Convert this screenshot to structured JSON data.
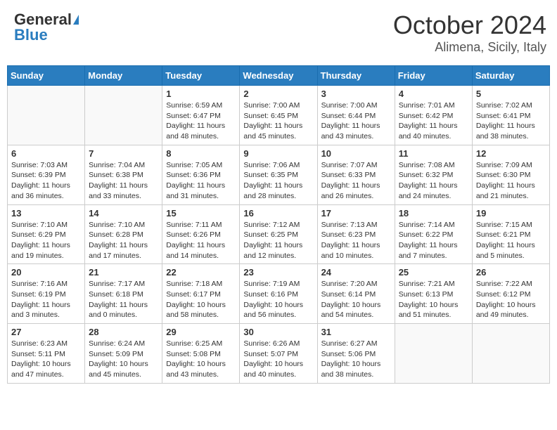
{
  "header": {
    "logo_general": "General",
    "logo_blue": "Blue",
    "title": "October 2024",
    "subtitle": "Alimena, Sicily, Italy"
  },
  "days_of_week": [
    "Sunday",
    "Monday",
    "Tuesday",
    "Wednesday",
    "Thursday",
    "Friday",
    "Saturday"
  ],
  "weeks": [
    [
      {
        "day": "",
        "info": ""
      },
      {
        "day": "",
        "info": ""
      },
      {
        "day": "1",
        "info": "Sunrise: 6:59 AM\nSunset: 6:47 PM\nDaylight: 11 hours and 48 minutes."
      },
      {
        "day": "2",
        "info": "Sunrise: 7:00 AM\nSunset: 6:45 PM\nDaylight: 11 hours and 45 minutes."
      },
      {
        "day": "3",
        "info": "Sunrise: 7:00 AM\nSunset: 6:44 PM\nDaylight: 11 hours and 43 minutes."
      },
      {
        "day": "4",
        "info": "Sunrise: 7:01 AM\nSunset: 6:42 PM\nDaylight: 11 hours and 40 minutes."
      },
      {
        "day": "5",
        "info": "Sunrise: 7:02 AM\nSunset: 6:41 PM\nDaylight: 11 hours and 38 minutes."
      }
    ],
    [
      {
        "day": "6",
        "info": "Sunrise: 7:03 AM\nSunset: 6:39 PM\nDaylight: 11 hours and 36 minutes."
      },
      {
        "day": "7",
        "info": "Sunrise: 7:04 AM\nSunset: 6:38 PM\nDaylight: 11 hours and 33 minutes."
      },
      {
        "day": "8",
        "info": "Sunrise: 7:05 AM\nSunset: 6:36 PM\nDaylight: 11 hours and 31 minutes."
      },
      {
        "day": "9",
        "info": "Sunrise: 7:06 AM\nSunset: 6:35 PM\nDaylight: 11 hours and 28 minutes."
      },
      {
        "day": "10",
        "info": "Sunrise: 7:07 AM\nSunset: 6:33 PM\nDaylight: 11 hours and 26 minutes."
      },
      {
        "day": "11",
        "info": "Sunrise: 7:08 AM\nSunset: 6:32 PM\nDaylight: 11 hours and 24 minutes."
      },
      {
        "day": "12",
        "info": "Sunrise: 7:09 AM\nSunset: 6:30 PM\nDaylight: 11 hours and 21 minutes."
      }
    ],
    [
      {
        "day": "13",
        "info": "Sunrise: 7:10 AM\nSunset: 6:29 PM\nDaylight: 11 hours and 19 minutes."
      },
      {
        "day": "14",
        "info": "Sunrise: 7:10 AM\nSunset: 6:28 PM\nDaylight: 11 hours and 17 minutes."
      },
      {
        "day": "15",
        "info": "Sunrise: 7:11 AM\nSunset: 6:26 PM\nDaylight: 11 hours and 14 minutes."
      },
      {
        "day": "16",
        "info": "Sunrise: 7:12 AM\nSunset: 6:25 PM\nDaylight: 11 hours and 12 minutes."
      },
      {
        "day": "17",
        "info": "Sunrise: 7:13 AM\nSunset: 6:23 PM\nDaylight: 11 hours and 10 minutes."
      },
      {
        "day": "18",
        "info": "Sunrise: 7:14 AM\nSunset: 6:22 PM\nDaylight: 11 hours and 7 minutes."
      },
      {
        "day": "19",
        "info": "Sunrise: 7:15 AM\nSunset: 6:21 PM\nDaylight: 11 hours and 5 minutes."
      }
    ],
    [
      {
        "day": "20",
        "info": "Sunrise: 7:16 AM\nSunset: 6:19 PM\nDaylight: 11 hours and 3 minutes."
      },
      {
        "day": "21",
        "info": "Sunrise: 7:17 AM\nSunset: 6:18 PM\nDaylight: 11 hours and 0 minutes."
      },
      {
        "day": "22",
        "info": "Sunrise: 7:18 AM\nSunset: 6:17 PM\nDaylight: 10 hours and 58 minutes."
      },
      {
        "day": "23",
        "info": "Sunrise: 7:19 AM\nSunset: 6:16 PM\nDaylight: 10 hours and 56 minutes."
      },
      {
        "day": "24",
        "info": "Sunrise: 7:20 AM\nSunset: 6:14 PM\nDaylight: 10 hours and 54 minutes."
      },
      {
        "day": "25",
        "info": "Sunrise: 7:21 AM\nSunset: 6:13 PM\nDaylight: 10 hours and 51 minutes."
      },
      {
        "day": "26",
        "info": "Sunrise: 7:22 AM\nSunset: 6:12 PM\nDaylight: 10 hours and 49 minutes."
      }
    ],
    [
      {
        "day": "27",
        "info": "Sunrise: 6:23 AM\nSunset: 5:11 PM\nDaylight: 10 hours and 47 minutes."
      },
      {
        "day": "28",
        "info": "Sunrise: 6:24 AM\nSunset: 5:09 PM\nDaylight: 10 hours and 45 minutes."
      },
      {
        "day": "29",
        "info": "Sunrise: 6:25 AM\nSunset: 5:08 PM\nDaylight: 10 hours and 43 minutes."
      },
      {
        "day": "30",
        "info": "Sunrise: 6:26 AM\nSunset: 5:07 PM\nDaylight: 10 hours and 40 minutes."
      },
      {
        "day": "31",
        "info": "Sunrise: 6:27 AM\nSunset: 5:06 PM\nDaylight: 10 hours and 38 minutes."
      },
      {
        "day": "",
        "info": ""
      },
      {
        "day": "",
        "info": ""
      }
    ]
  ]
}
